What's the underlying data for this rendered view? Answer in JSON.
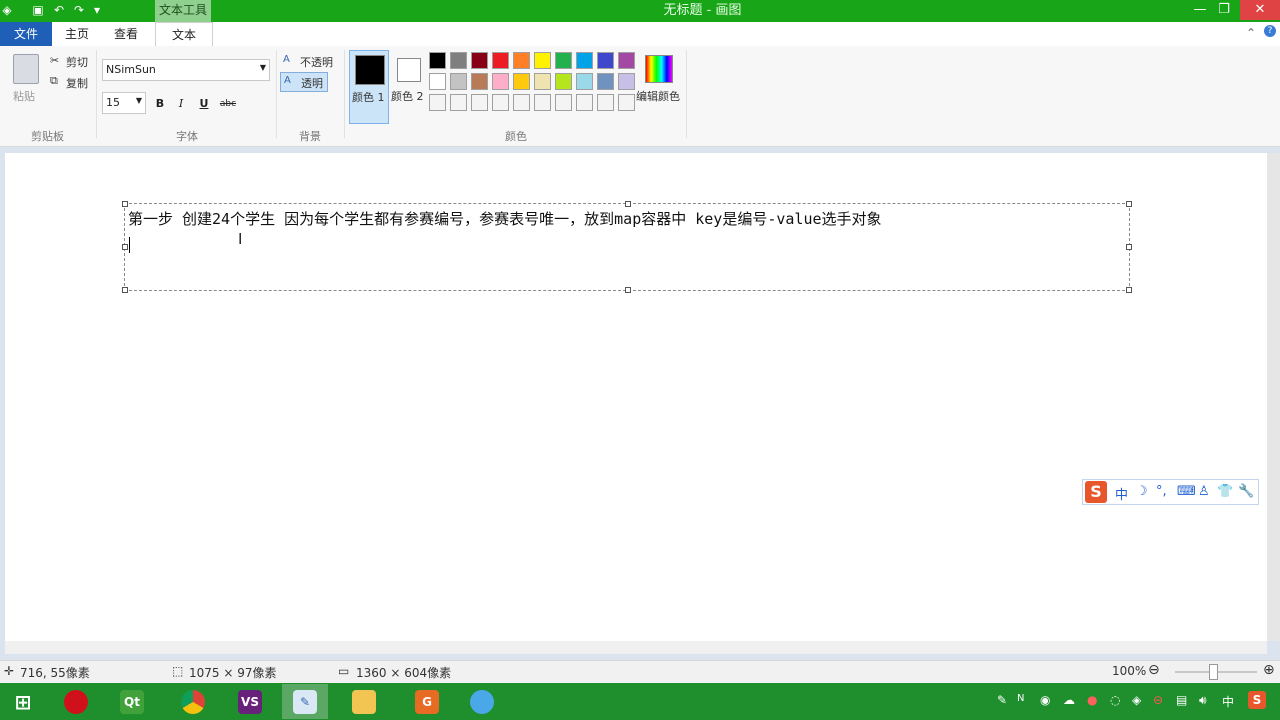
{
  "titlebar": {
    "context_tab": "文本工具",
    "window_title": "无标题 - 画图",
    "minimize": "—",
    "maximize": "❐",
    "close": "✕"
  },
  "tabs": {
    "file": "文件",
    "home": "主页",
    "view": "查看",
    "text": "文本"
  },
  "ribbon": {
    "clipboard": {
      "paste": "粘贴",
      "cut": "剪切",
      "copy": "复制",
      "group": "剪贴板"
    },
    "font": {
      "family": "NSimSun",
      "size": "15",
      "bold": "B",
      "italic": "I",
      "underline": "U",
      "strike": "abc",
      "group": "字体"
    },
    "background": {
      "opaque": "不透明",
      "transparent": "透明",
      "group": "背景"
    },
    "colors": {
      "color1": "颜色 1",
      "color2": "颜色 2",
      "edit": "编辑颜色",
      "group": "颜色",
      "color1_value": "#000000",
      "color2_value": "#ffffff",
      "palette_row1": [
        "#000000",
        "#7f7f7f",
        "#880015",
        "#ed1c24",
        "#ff7f27",
        "#fff200",
        "#22b14c",
        "#00a2e8",
        "#3f48cc",
        "#a349a4"
      ],
      "palette_row2": [
        "#ffffff",
        "#c3c3c3",
        "#b97a57",
        "#ffaec9",
        "#ffc90e",
        "#efe4b0",
        "#b5e61d",
        "#99d9ea",
        "#7092be",
        "#c8bfe7"
      ],
      "palette_row3": [
        "#f4f4f4",
        "#f4f4f4",
        "#f4f4f4",
        "#f4f4f4",
        "#f4f4f4",
        "#f4f4f4",
        "#f4f4f4",
        "#f4f4f4",
        "#f4f4f4",
        "#f4f4f4"
      ]
    }
  },
  "canvas": {
    "text": "第一步 创建24个学生  因为每个学生都有参赛编号，参赛表号唯一，放到map容器中 key是编号-value选手对象"
  },
  "ime": {
    "logo": "S",
    "items": [
      "中",
      "☽",
      "°,",
      "⌨",
      "♙",
      "👕",
      "🔧"
    ]
  },
  "status": {
    "cursor_pos": "716, 55像素",
    "selection_size": "1075 × 97像素",
    "image_size": "1360 × 604像素",
    "zoom": "100%"
  },
  "taskbar": {
    "apps": [
      "start",
      "record",
      "qt",
      "chrome",
      "visual-studio",
      "paint",
      "explorer",
      "wps",
      "qq"
    ],
    "tray_ime": "中",
    "tray_s": "S"
  }
}
